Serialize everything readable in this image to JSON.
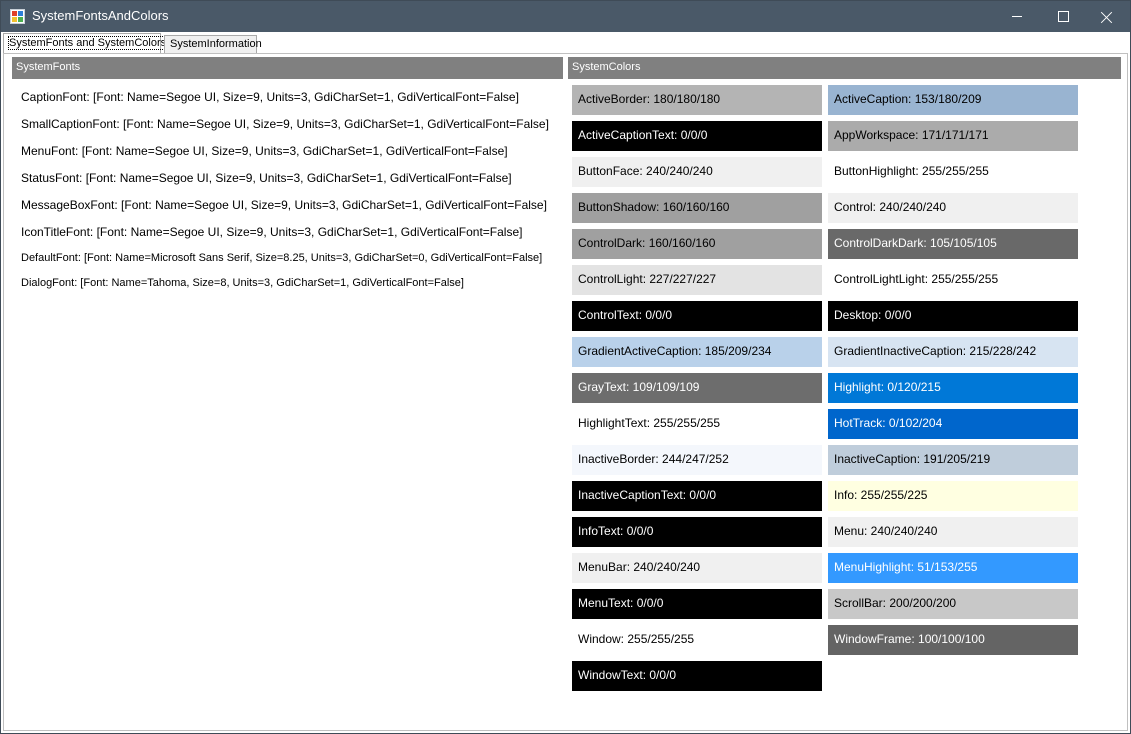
{
  "window": {
    "title": "SystemFontsAndColors"
  },
  "tabs": [
    {
      "label": "SystemFonts and SystemColors",
      "active": true
    },
    {
      "label": "SystemInformation",
      "active": false
    }
  ],
  "fonts_panel": {
    "header": "SystemFonts",
    "items": [
      {
        "name": "CaptionFont",
        "text": "CaptionFont: [Font: Name=Segoe UI, Size=9, Units=3, GdiCharSet=1, GdiVerticalFont=False]"
      },
      {
        "name": "SmallCaptionFont",
        "text": "SmallCaptionFont: [Font: Name=Segoe UI, Size=9, Units=3, GdiCharSet=1, GdiVerticalFont=False]"
      },
      {
        "name": "MenuFont",
        "text": "MenuFont: [Font: Name=Segoe UI, Size=9, Units=3, GdiCharSet=1, GdiVerticalFont=False]"
      },
      {
        "name": "StatusFont",
        "text": "StatusFont: [Font: Name=Segoe UI, Size=9, Units=3, GdiCharSet=1, GdiVerticalFont=False]"
      },
      {
        "name": "MessageBoxFont",
        "text": "MessageBoxFont: [Font: Name=Segoe UI, Size=9, Units=3, GdiCharSet=1, GdiVerticalFont=False]"
      },
      {
        "name": "IconTitleFont",
        "text": "IconTitleFont: [Font: Name=Segoe UI, Size=9, Units=3, GdiCharSet=1, GdiVerticalFont=False]"
      },
      {
        "name": "DefaultFont",
        "text": "DefaultFont: [Font: Name=Microsoft Sans Serif, Size=8.25, Units=3, GdiCharSet=0, GdiVerticalFont=False]"
      },
      {
        "name": "DialogFont",
        "text": "DialogFont: [Font: Name=Tahoma, Size=8, Units=3, GdiCharSet=1, GdiVerticalFont=False]"
      }
    ]
  },
  "colors_panel": {
    "header": "SystemColors",
    "items": [
      {
        "label": "ActiveBorder: 180/180/180",
        "bg": "#b4b4b4",
        "fg": "#000000"
      },
      {
        "label": "ActiveCaption: 153/180/209",
        "bg": "#99b4d1",
        "fg": "#000000"
      },
      {
        "label": "ActiveCaptionText: 0/0/0",
        "bg": "#000000",
        "fg": "#ffffff"
      },
      {
        "label": "AppWorkspace: 171/171/171",
        "bg": "#ababab",
        "fg": "#000000"
      },
      {
        "label": "ButtonFace: 240/240/240",
        "bg": "#f0f0f0",
        "fg": "#000000"
      },
      {
        "label": "ButtonHighlight: 255/255/255",
        "bg": "#ffffff",
        "fg": "#000000"
      },
      {
        "label": "ButtonShadow: 160/160/160",
        "bg": "#a0a0a0",
        "fg": "#000000"
      },
      {
        "label": "Control: 240/240/240",
        "bg": "#f0f0f0",
        "fg": "#000000"
      },
      {
        "label": "ControlDark: 160/160/160",
        "bg": "#a0a0a0",
        "fg": "#000000"
      },
      {
        "label": "ControlDarkDark: 105/105/105",
        "bg": "#696969",
        "fg": "#ffffff"
      },
      {
        "label": "ControlLight: 227/227/227",
        "bg": "#e3e3e3",
        "fg": "#000000"
      },
      {
        "label": "ControlLightLight: 255/255/255",
        "bg": "#ffffff",
        "fg": "#000000"
      },
      {
        "label": "ControlText: 0/0/0",
        "bg": "#000000",
        "fg": "#ffffff"
      },
      {
        "label": "Desktop: 0/0/0",
        "bg": "#000000",
        "fg": "#ffffff"
      },
      {
        "label": "GradientActiveCaption: 185/209/234",
        "bg": "#b9d1ea",
        "fg": "#000000"
      },
      {
        "label": "GradientInactiveCaption: 215/228/242",
        "bg": "#d7e4f2",
        "fg": "#000000"
      },
      {
        "label": "GrayText: 109/109/109",
        "bg": "#6d6d6d",
        "fg": "#ffffff"
      },
      {
        "label": "Highlight: 0/120/215",
        "bg": "#0078d7",
        "fg": "#ffffff"
      },
      {
        "label": "HighlightText: 255/255/255",
        "bg": "#ffffff",
        "fg": "#000000"
      },
      {
        "label": "HotTrack: 0/102/204",
        "bg": "#0066cc",
        "fg": "#ffffff"
      },
      {
        "label": "InactiveBorder: 244/247/252",
        "bg": "#f4f7fc",
        "fg": "#000000"
      },
      {
        "label": "InactiveCaption: 191/205/219",
        "bg": "#bfcddb",
        "fg": "#000000"
      },
      {
        "label": "InactiveCaptionText: 0/0/0",
        "bg": "#000000",
        "fg": "#ffffff"
      },
      {
        "label": "Info: 255/255/225",
        "bg": "#ffffe1",
        "fg": "#000000"
      },
      {
        "label": "InfoText: 0/0/0",
        "bg": "#000000",
        "fg": "#ffffff"
      },
      {
        "label": "Menu: 240/240/240",
        "bg": "#f0f0f0",
        "fg": "#000000"
      },
      {
        "label": "MenuBar: 240/240/240",
        "bg": "#f0f0f0",
        "fg": "#000000"
      },
      {
        "label": "MenuHighlight: 51/153/255",
        "bg": "#3399ff",
        "fg": "#ffffff"
      },
      {
        "label": "MenuText: 0/0/0",
        "bg": "#000000",
        "fg": "#ffffff"
      },
      {
        "label": "ScrollBar: 200/200/200",
        "bg": "#c8c8c8",
        "fg": "#000000"
      },
      {
        "label": "Window: 255/255/255",
        "bg": "#ffffff",
        "fg": "#000000"
      },
      {
        "label": "WindowFrame: 100/100/100",
        "bg": "#646464",
        "fg": "#ffffff"
      },
      {
        "label": "WindowText: 0/0/0",
        "bg": "#000000",
        "fg": "#ffffff"
      }
    ]
  }
}
